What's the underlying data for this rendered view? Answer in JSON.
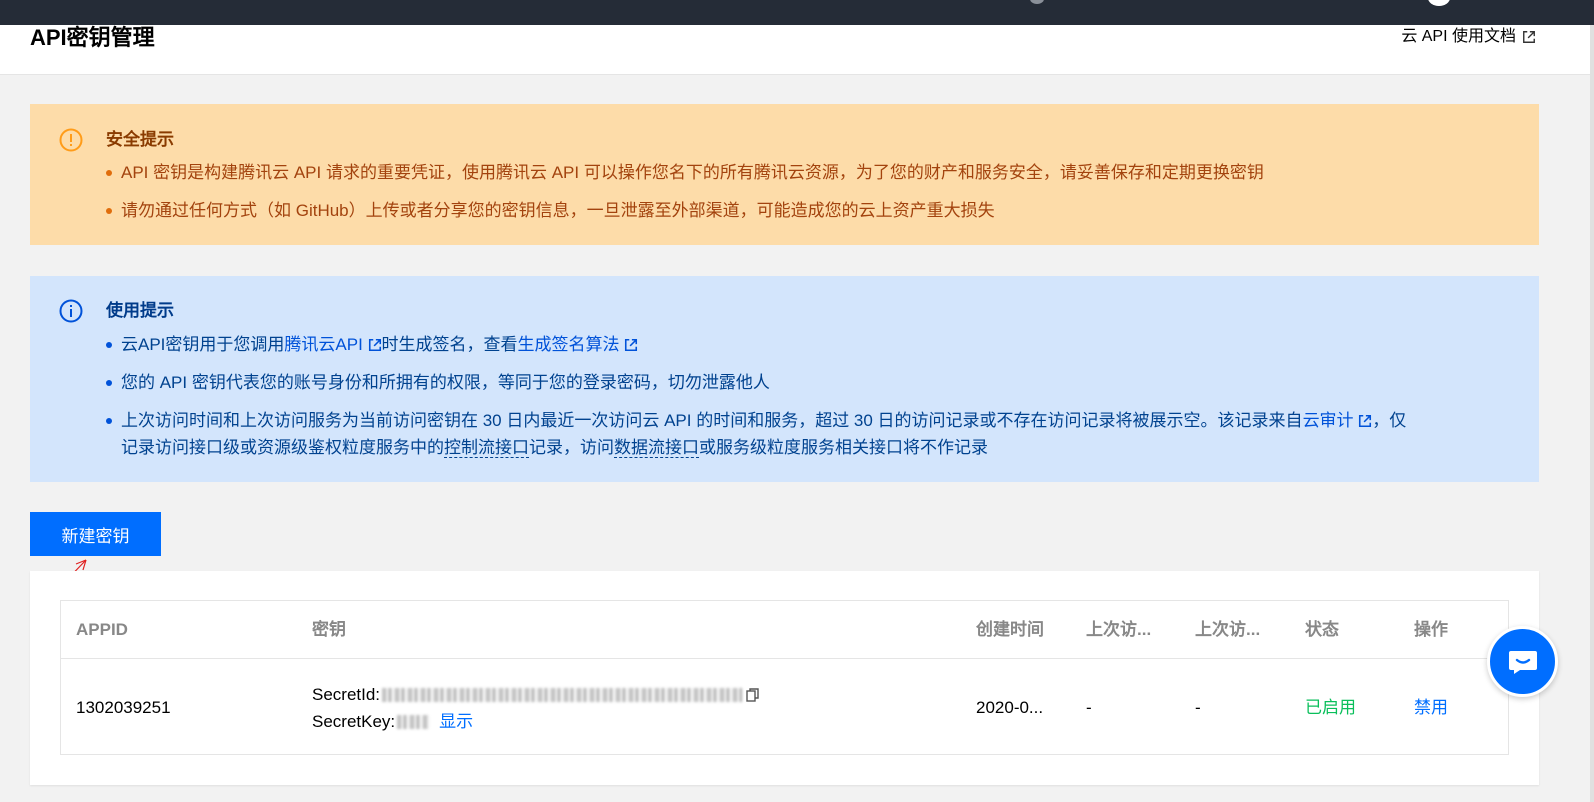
{
  "header": {
    "title": "API密钥管理",
    "doc_link": "云 API 使用文档"
  },
  "security_notice": {
    "title": "安全提示",
    "items": [
      "API 密钥是构建腾讯云 API 请求的重要凭证，使用腾讯云 API 可以操作您名下的所有腾讯云资源，为了您的财产和服务安全，请妥善保存和定期更换密钥",
      "请勿通过任何方式（如 GitHub）上传或者分享您的密钥信息，一旦泄露至外部渠道，可能造成您的云上资产重大损失"
    ]
  },
  "usage_notice": {
    "title": "使用提示",
    "item1": {
      "prefix": "云API密钥用于您调用",
      "link1": "腾讯云API",
      "middle": "时生成签名，查看",
      "link2": "生成签名算法"
    },
    "item2": "您的 API 密钥代表您的账号身份和所拥有的权限，等同于您的登录密码，切勿泄露他人",
    "item3": {
      "text1": "上次访问时间和上次访问服务为当前访问密钥在 30 日内最近一次访问云 API 的时间和服务，超过 30 日的访问记录或不存在访问记录将被展示空。该记录来自",
      "link": "云审计",
      "text2": "，仅",
      "text3": "记录访问接口级或资源级鉴权粒度服务中的",
      "term1": "控制流接口",
      "text4": "记录，访问",
      "term2": "数据流接口",
      "text5": "或服务级粒度服务相关接口将不作记录"
    }
  },
  "actions": {
    "new_key": "新建密钥"
  },
  "table": {
    "columns": {
      "appid": "APPID",
      "key": "密钥",
      "created": "创建时间",
      "last_access_time": "上次访...",
      "last_access_service": "上次访...",
      "status": "状态",
      "operation": "操作"
    },
    "rows": [
      {
        "appid": "1302039251",
        "secret_id_label": "SecretId:",
        "secret_key_label": "SecretKey:",
        "show_label": "显示",
        "created": "2020-0...",
        "last_access_time": "-",
        "last_access_service": "-",
        "status": "已启用",
        "operation": "禁用"
      }
    ]
  },
  "colors": {
    "primary": "#006eff",
    "warning_bg": "#fddca9",
    "info_bg": "#d3e5fc",
    "success": "#0abf5b",
    "topbar": "#252c37"
  }
}
